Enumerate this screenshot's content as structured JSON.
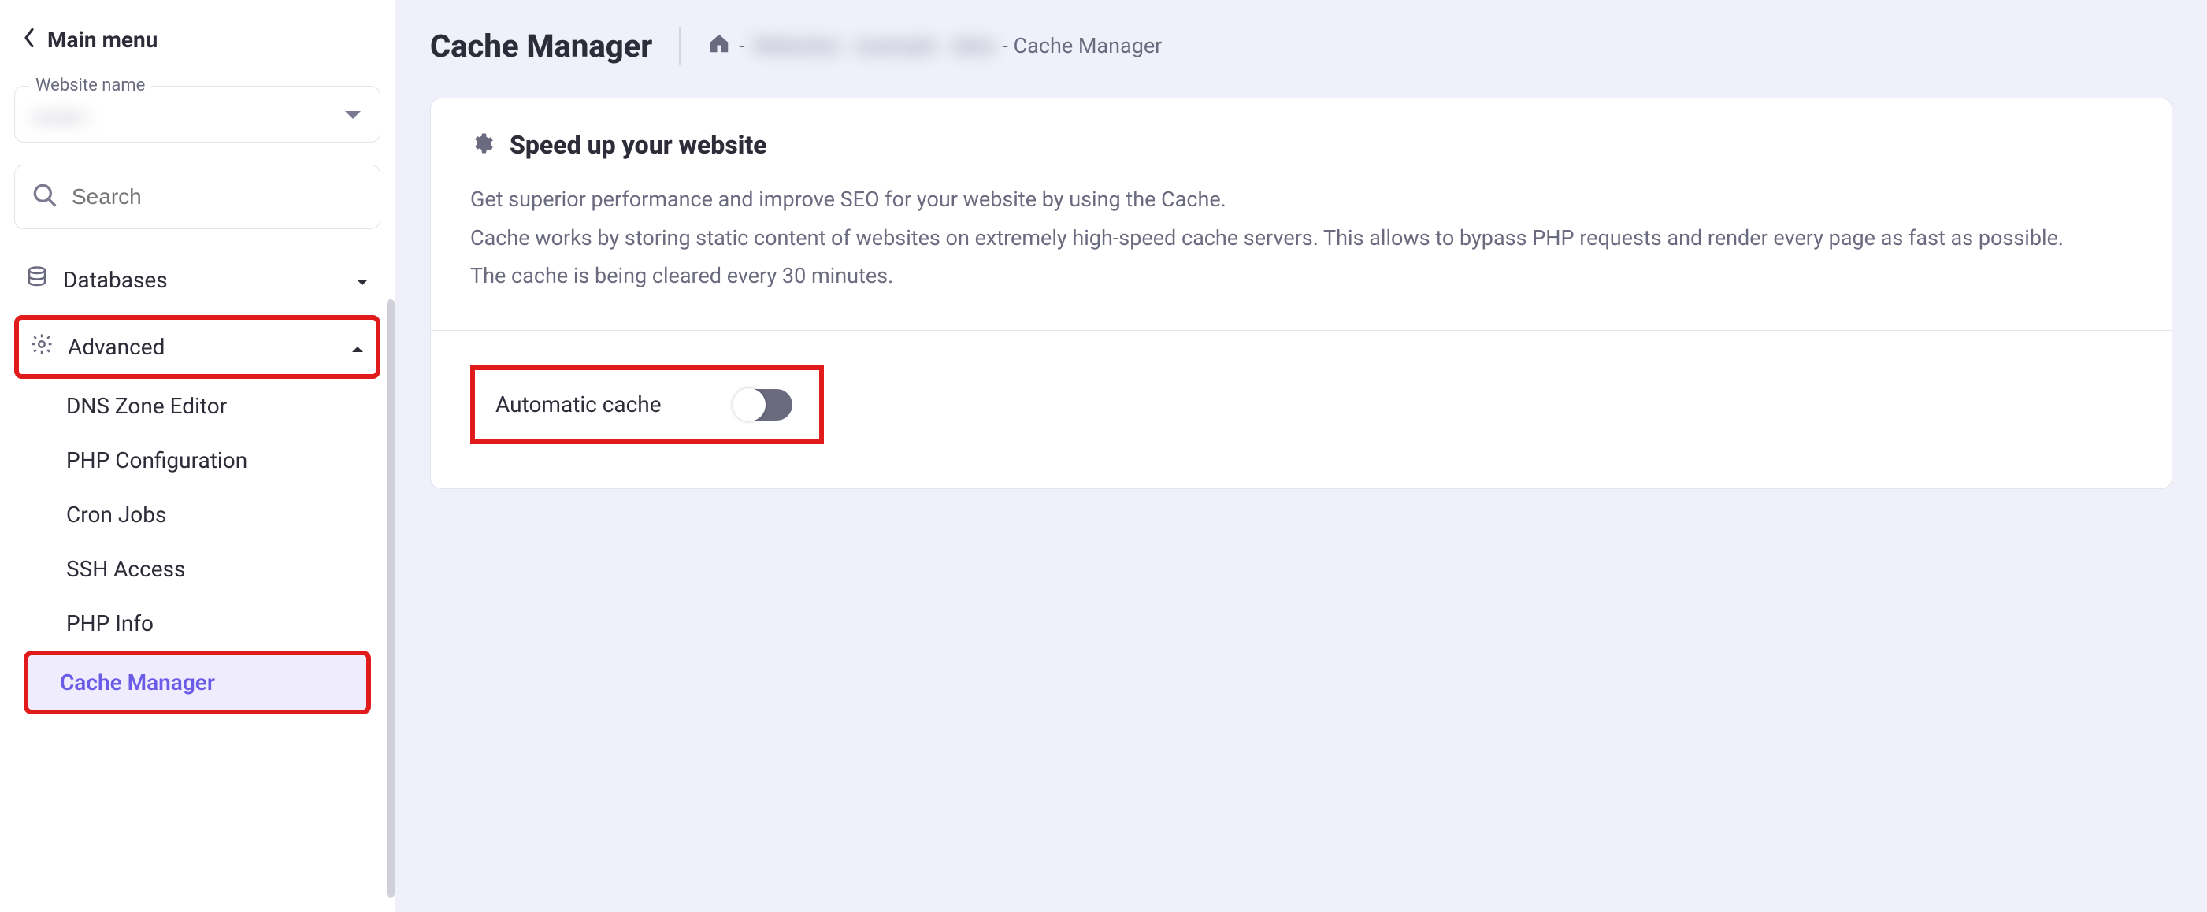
{
  "sidebar": {
    "back_label": "Main menu",
    "website_label": "Website name",
    "website_value": "example.c",
    "search_placeholder": "Search",
    "items": {
      "databases": "Databases",
      "advanced": "Advanced"
    },
    "sub": {
      "dns": "DNS Zone Editor",
      "php_config": "PHP Configuration",
      "cron": "Cron Jobs",
      "ssh": "SSH Access",
      "php_info": "PHP Info",
      "cache": "Cache Manager"
    }
  },
  "page": {
    "title": "Cache Manager",
    "breadcrumb_sep": "-",
    "breadcrumb_mid": "Websites · example · deta",
    "breadcrumb_last": " - Cache Manager"
  },
  "card": {
    "title": "Speed up your website",
    "p1": "Get superior performance and improve SEO for your website by using the Cache.",
    "p2": "Cache works by storing static content of websites on extremely high-speed cache servers. This allows to bypass PHP requests and render every page as fast as possible.",
    "p3": "The cache is being cleared every 30 minutes.",
    "toggle_label": "Automatic cache",
    "toggle_state": "off"
  }
}
